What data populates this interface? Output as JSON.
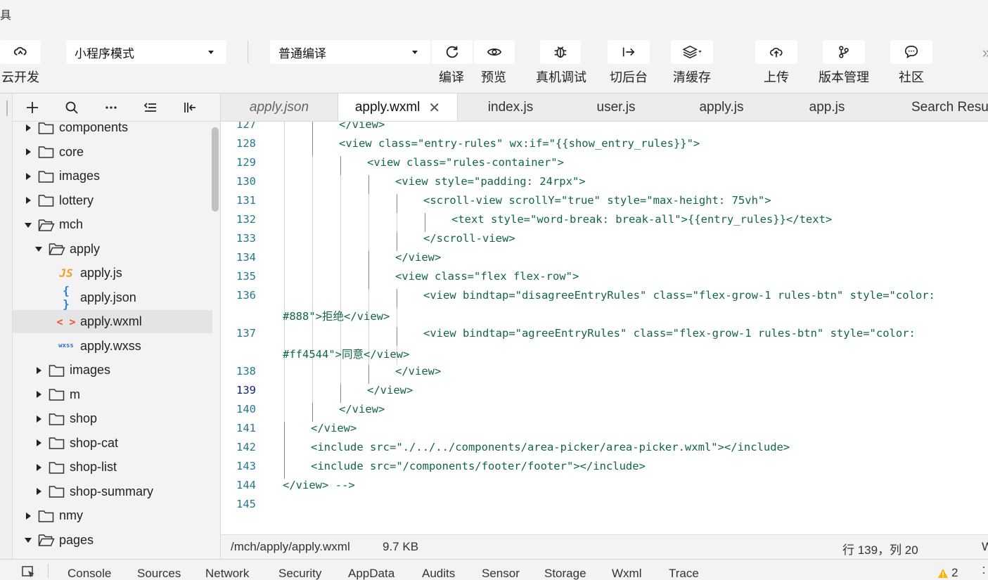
{
  "window_title": "具",
  "toolbar": {
    "cloud_label": "云开发",
    "mode_select": "小程序模式",
    "compile_select": "普通编译",
    "compile_label": "编译",
    "preview_label": "预览",
    "debug_label": "真机调试",
    "background_label": "切后台",
    "clear_cache_label": "清缓存",
    "upload_label": "上传",
    "version_label": "版本管理",
    "community_label": "社区",
    "more": "»"
  },
  "sidebar": {
    "tree": [
      {
        "label": "components",
        "kind": "folder",
        "level": 1,
        "expanded": false
      },
      {
        "label": "core",
        "kind": "folder",
        "level": 1,
        "expanded": false
      },
      {
        "label": "images",
        "kind": "folder",
        "level": 1,
        "expanded": false
      },
      {
        "label": "lottery",
        "kind": "folder",
        "level": 1,
        "expanded": false
      },
      {
        "label": "mch",
        "kind": "folder",
        "level": 1,
        "expanded": true
      },
      {
        "label": "apply",
        "kind": "folder",
        "level": 2,
        "expanded": true
      },
      {
        "label": "apply.js",
        "kind": "js",
        "level": 3,
        "badge": "JS"
      },
      {
        "label": "apply.json",
        "kind": "json",
        "level": 3,
        "badge": "{ }"
      },
      {
        "label": "apply.wxml",
        "kind": "wxml",
        "level": 3,
        "badge": "< >",
        "selected": true
      },
      {
        "label": "apply.wxss",
        "kind": "wxss",
        "level": 3,
        "badge": "wxss"
      },
      {
        "label": "images",
        "kind": "folder",
        "level": 2,
        "expanded": false
      },
      {
        "label": "m",
        "kind": "folder",
        "level": 2,
        "expanded": false
      },
      {
        "label": "shop",
        "kind": "folder",
        "level": 2,
        "expanded": false
      },
      {
        "label": "shop-cat",
        "kind": "folder",
        "level": 2,
        "expanded": false
      },
      {
        "label": "shop-list",
        "kind": "folder",
        "level": 2,
        "expanded": false
      },
      {
        "label": "shop-summary",
        "kind": "folder",
        "level": 2,
        "expanded": false
      },
      {
        "label": "nmy",
        "kind": "folder",
        "level": 1,
        "expanded": false
      },
      {
        "label": "pages",
        "kind": "folder",
        "level": 1,
        "expanded": true
      }
    ]
  },
  "tabs": [
    {
      "label": "apply.json",
      "italic": true
    },
    {
      "label": "apply.wxml",
      "active": true,
      "close": "✕"
    },
    {
      "label": "index.js"
    },
    {
      "label": "user.js"
    },
    {
      "label": "apply.js"
    },
    {
      "label": "app.js"
    },
    {
      "label": "Search Resu"
    }
  ],
  "editor": {
    "lines": [
      {
        "n": "127",
        "indent": 2,
        "text": "</view>"
      },
      {
        "n": "128",
        "indent": 2,
        "text": "<view class=\"entry-rules\" wx:if=\"{{show_entry_rules}}\">"
      },
      {
        "n": "129",
        "indent": 3,
        "text": "<view class=\"rules-container\">"
      },
      {
        "n": "130",
        "indent": 4,
        "text": "<view style=\"padding: 24rpx\">"
      },
      {
        "n": "131",
        "indent": 5,
        "text": "<scroll-view scrollY=\"true\" style=\"max-height: 75vh\">"
      },
      {
        "n": "132",
        "indent": 6,
        "text": "<text style=\"word-break: break-all\">{{entry_rules}}</text>"
      },
      {
        "n": "133",
        "indent": 5,
        "text": "</scroll-view>"
      },
      {
        "n": "134",
        "indent": 4,
        "text": "</view>"
      },
      {
        "n": "135",
        "indent": 4,
        "text": "<view class=\"flex flex-row\">"
      },
      {
        "n": "136",
        "indent": 5,
        "text": "<view bindtap=\"disagreeEntryRules\" class=\"flex-grow-1 rules-btn\" style=\"color:"
      },
      {
        "n": "",
        "indent": 0,
        "text": "#888\">拒绝</view>"
      },
      {
        "n": "137",
        "indent": 5,
        "text": "<view bindtap=\"agreeEntryRules\" class=\"flex-grow-1 rules-btn\" style=\"color:"
      },
      {
        "n": "",
        "indent": 0,
        "text": "#ff4544\">同意</view>"
      },
      {
        "n": "138",
        "indent": 4,
        "text": "</view>"
      },
      {
        "n": "139",
        "indent": 3,
        "text": "</view>",
        "current": true
      },
      {
        "n": "140",
        "indent": 2,
        "text": "</view>"
      },
      {
        "n": "141",
        "indent": 1,
        "text": "</view>"
      },
      {
        "n": "142",
        "indent": 1,
        "text": "<include src=\"./../../components/area-picker/area-picker.wxml\"></include>"
      },
      {
        "n": "143",
        "indent": 1,
        "text": "<include src=\"/components/footer/footer\"></include>"
      },
      {
        "n": "144",
        "indent": 0,
        "text": "</view> -->"
      },
      {
        "n": "145",
        "indent": 0,
        "text": ""
      }
    ]
  },
  "status": {
    "path": "/mch/apply/apply.wxml",
    "size": "9.7 KB",
    "cursor": "行 139，列 20",
    "extra": "W"
  },
  "devtools": {
    "tabs": [
      "Console",
      "Sources",
      "Network",
      "Security",
      "AppData",
      "Audits",
      "Sensor",
      "Storage",
      "Wxml",
      "Trace"
    ],
    "warnings": "2"
  },
  "colors": {
    "code_text": "#116644",
    "line_number": "#237893",
    "selection": "#e4e4e4"
  }
}
